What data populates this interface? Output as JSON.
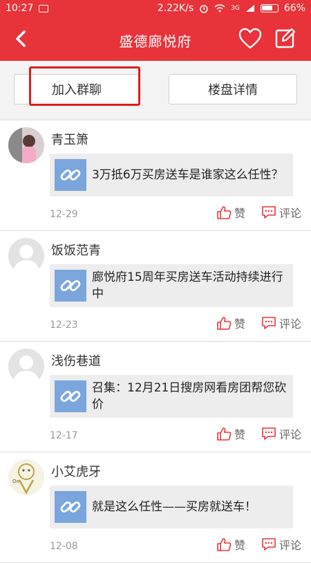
{
  "status_bar": {
    "time": "10:27",
    "net_speed": "2.22K/s",
    "signal_label": "3G",
    "battery": "66%"
  },
  "header": {
    "title": "盛德廊悦府",
    "back_icon": "back-arrow-icon",
    "heart_icon": "heart-icon",
    "edit_icon": "edit-icon"
  },
  "actions": {
    "join_label": "加入群聊",
    "detail_label": "楼盘详情"
  },
  "posts": [
    {
      "author": "青玉箫",
      "text": "3万抵6万买房送车是谁家这么任性？",
      "date": "12-29",
      "like_label": "赞",
      "comment_label": "评论"
    },
    {
      "author": "饭饭范青",
      "text": "廊悦府15周年买房送车活动持续进行中",
      "date": "12-23",
      "like_label": "赞",
      "comment_label": "评论"
    },
    {
      "author": "浅伤巷道",
      "text": "召集：12月21日搜房网看房团帮您砍价",
      "date": "12-17",
      "like_label": "赞",
      "comment_label": "评论"
    },
    {
      "author": "小艾虎牙",
      "text": "就是这么任性——买房就送车！",
      "date": "12-08",
      "like_label": "赞",
      "comment_label": "评论"
    }
  ],
  "colors": {
    "brand": "#e8333a",
    "link_thumb": "#7aa6dd",
    "highlight": "#e01c1c"
  }
}
